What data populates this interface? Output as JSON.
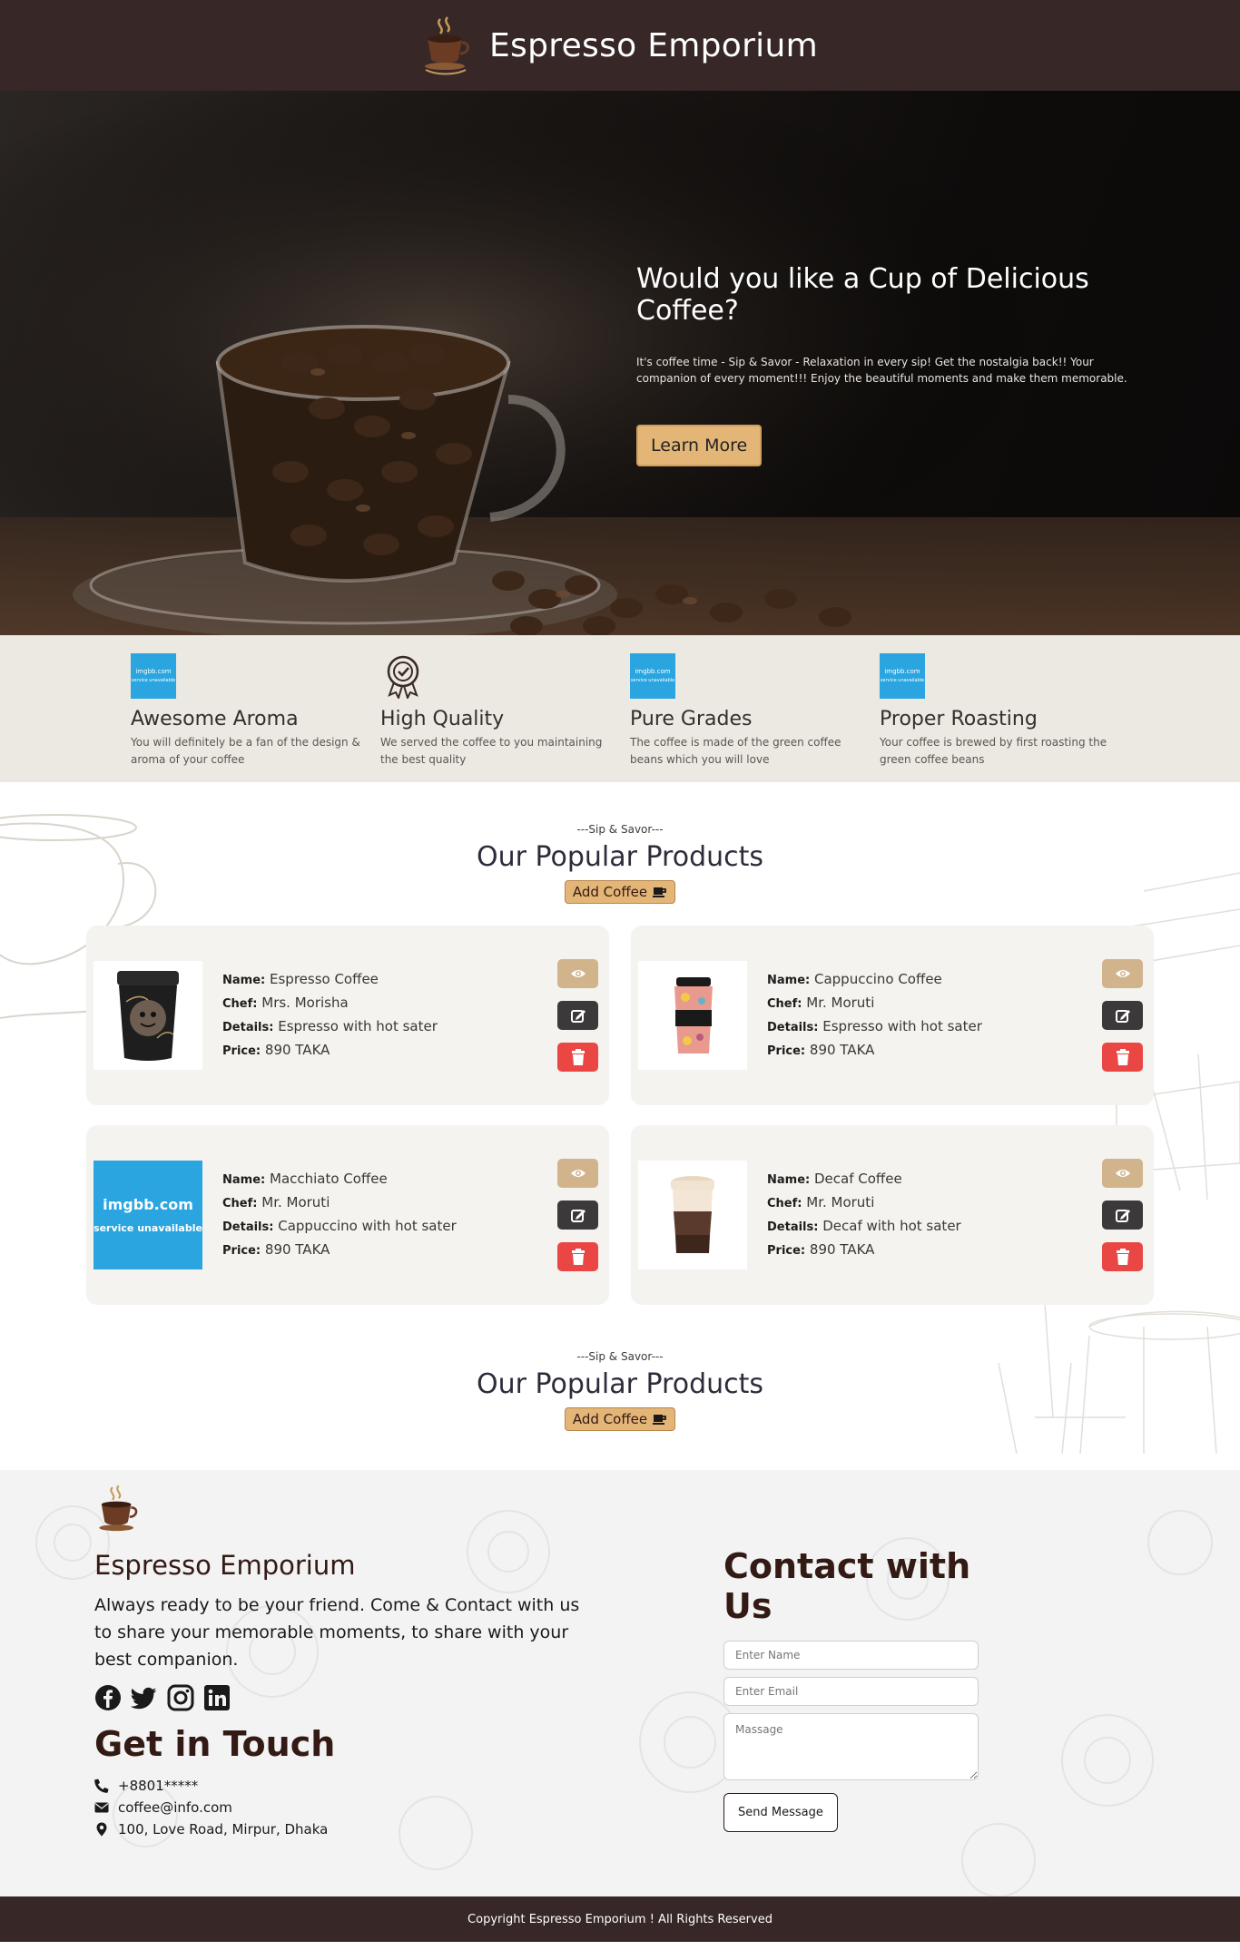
{
  "header": {
    "title": "Espresso Emporium",
    "logo_icon": "coffee-cup-logo-icon"
  },
  "hero": {
    "title": "Would you like a Cup of Delicious Coffee?",
    "text": "It's coffee time - Sip & Savor - Relaxation in every sip! Get the nostalgia back!! Your companion of every moment!!! Enjoy the beautiful moments and make them memorable.",
    "button_label": "Learn More"
  },
  "features": [
    {
      "icon": "imgbb-placeholder",
      "icon_text_1": "imgbb.com",
      "icon_text_2": "service unavailable",
      "title": "Awesome Aroma",
      "desc": "You will definitely be a fan of the design & aroma of your coffee"
    },
    {
      "icon": "quality-badge-icon",
      "title": "High Quality",
      "desc": "We served the coffee to you maintaining the best quality"
    },
    {
      "icon": "imgbb-placeholder",
      "icon_text_1": "imgbb.com",
      "icon_text_2": "service unavailable",
      "title": "Pure Grades",
      "desc": "The coffee is made of the green coffee beans which you will love"
    },
    {
      "icon": "imgbb-placeholder",
      "icon_text_1": "imgbb.com",
      "icon_text_2": "service unavailable",
      "title": "Proper Roasting",
      "desc": "Your coffee is brewed by first roasting the green coffee beans"
    }
  ],
  "products_section": {
    "subtitle": "---Sip & Savor---",
    "title": "Our Popular Products",
    "add_label": "Add Coffee"
  },
  "labels": {
    "name": "Name:",
    "chef": "Chef:",
    "details": "Details:",
    "price": "Price:"
  },
  "products": [
    {
      "name": "Espresso Coffee",
      "chef": "Mrs. Morisha",
      "details": "Espresso with hot sater",
      "price": "890 TAKA",
      "image": "black-travel-mug"
    },
    {
      "name": "Cappuccino Coffee",
      "chef": "Mr. Moruti",
      "details": "Espresso with hot sater",
      "price": "890 TAKA",
      "image": "floral-cup"
    },
    {
      "name": "Macchiato Coffee",
      "chef": "Mr. Moruti",
      "details": "Cappuccino with hot sater",
      "price": "890 TAKA",
      "image": "imgbb-placeholder",
      "img_text_1": "imgbb.com",
      "img_text_2": "service unavailable"
    },
    {
      "name": "Decaf Coffee",
      "chef": "Mr. Moruti",
      "details": "Decaf with hot sater",
      "price": "890 TAKA",
      "image": "brown-paper-cup"
    }
  ],
  "products_section_2": {
    "subtitle": "---Sip & Savor---",
    "title": "Our Popular Products",
    "add_label": "Add Coffee"
  },
  "footer": {
    "brand": "Espresso Emporium",
    "about": "Always ready to be your friend. Come & Contact with us to share your memorable moments, to share with your best companion.",
    "social_icons": [
      "facebook-icon",
      "twitter-icon",
      "instagram-icon",
      "linkedin-icon"
    ],
    "touch_title": "Get in Touch",
    "phone": "+8801*****",
    "email": "coffee@info.com",
    "address": "100, Love Road, Mirpur, Dhaka",
    "contact_title": "Contact with Us",
    "name_placeholder": "Enter Name",
    "email_placeholder": "Enter Email",
    "message_placeholder": "Massage",
    "send_label": "Send Message",
    "copyright": "Copyright Espresso Emporium ! All Rights Reserved"
  },
  "colors": {
    "header_bg": "#372727",
    "accent": "#e3b577",
    "features_bg": "#ece8e2",
    "card_bg": "#f4f3f0",
    "view_btn": "#d2b48c",
    "edit_btn": "#3c393b",
    "delete_btn": "#ea4744",
    "heading": "#331a15"
  }
}
